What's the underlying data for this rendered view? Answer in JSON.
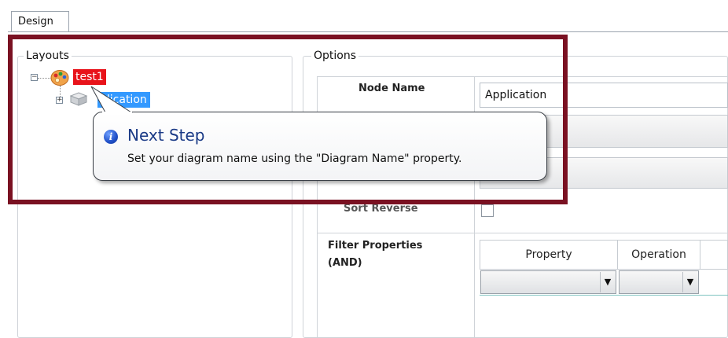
{
  "tabs": [
    {
      "label": "Design"
    }
  ],
  "layouts": {
    "legend": "Layouts",
    "tree": {
      "root": {
        "label": "test1",
        "icon": "palette-icon"
      },
      "child": {
        "label": "Application",
        "visible_label": "plication",
        "icon": "cube-icon"
      }
    }
  },
  "options": {
    "legend": "Options",
    "node_name": {
      "label": "Node Name",
      "value": "Application"
    },
    "sort_reverse": {
      "label": "Sort Reverse",
      "checked": false
    },
    "filter": {
      "label_line1": "Filter Properties",
      "label_line2": "(AND)",
      "columns": [
        "Property",
        "Operation"
      ],
      "dropdown_arrow": "▼"
    }
  },
  "tooltip": {
    "title": "Next Step",
    "message": "Set your diagram name using the \"Diagram Name\" property.",
    "icon": "info-icon"
  },
  "colors": {
    "highlight_border": "#7a1122",
    "selected_root_bg": "#e8131a",
    "selected_child_bg": "#3399ff",
    "tooltip_title": "#1a3a86"
  }
}
